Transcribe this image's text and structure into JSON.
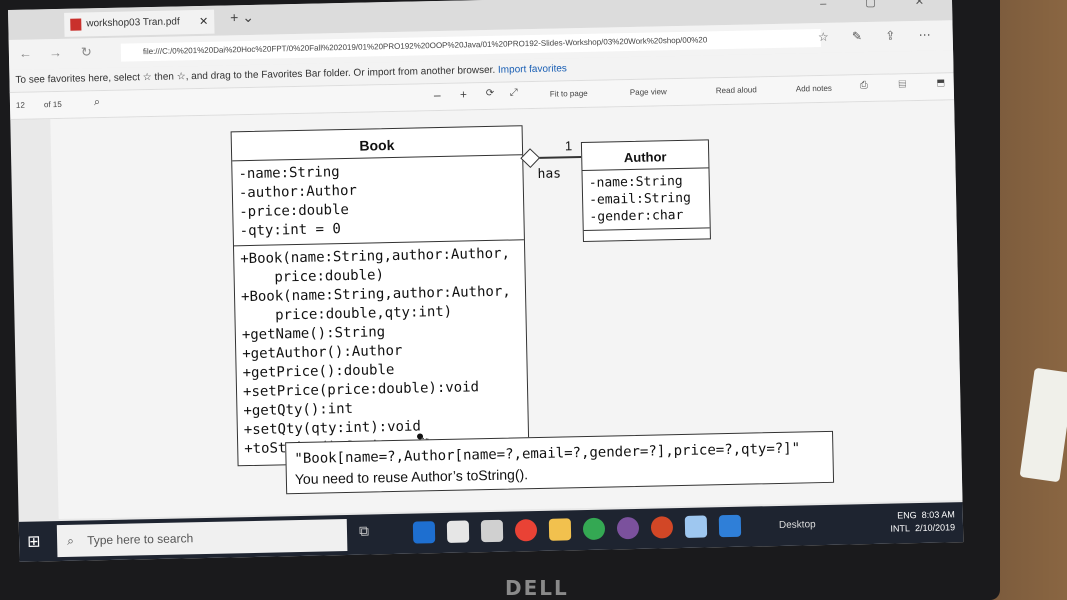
{
  "browser": {
    "tab_title": "workshop03 Tran.pdf",
    "url": "file:///C:/0%201%20Dai%20Hoc%20FPT/0%20Fall%202019/01%20PRO192%20OOP%20Java/01%20PRO192-Slides-Workshop/03%20Work%20shop/00%20",
    "favorites_text": "To see favorites here, select ☆ then ☆, and drag to the Favorites Bar folder. Or import from another browser.",
    "favorites_link": "Import favorites"
  },
  "pdf_toolbar": {
    "page": "12",
    "of": "of 15",
    "fit": "Fit to page",
    "page_view": "Page view",
    "read_aloud": "Read aloud",
    "add_notes": "Add notes"
  },
  "book": {
    "name": "Book",
    "attrs": [
      "-name:String",
      "-author:Author",
      "-price:double",
      "-qty:int = 0"
    ],
    "ops": [
      "+Book(name:String,author:Author,",
      "    price:double)",
      "+Book(name:String,author:Author,",
      "    price:double,qty:int)",
      "+getName():String",
      "+getAuthor():Author",
      "+getPrice():double",
      "+setPrice(price:double):void",
      "+getQty():int",
      "+setQty(qty:int):void",
      "+toString():String"
    ]
  },
  "author": {
    "name": "Author",
    "attrs": [
      "-name:String",
      "-email:String",
      "-gender:char"
    ]
  },
  "association": {
    "label": "has",
    "multiplicity": "1"
  },
  "note": {
    "line1": "\"Book[name=?,Author[name=?,email=?,gender=?],price=?,qty=?]\"",
    "line2": "You need to reuse Author’s toString()."
  },
  "taskbar": {
    "search_placeholder": "Type here to search",
    "desktop": "Desktop",
    "lang": "ENG",
    "layout": "INTL",
    "time": "8:03 AM",
    "date": "2/10/2019"
  },
  "brand": "DELL"
}
